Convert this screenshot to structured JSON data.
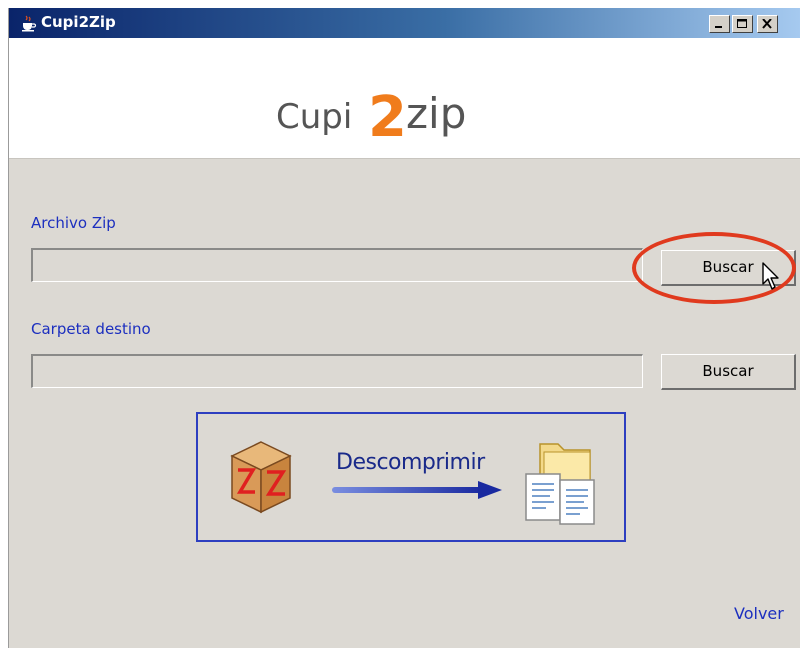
{
  "window": {
    "title": "Cupi2Zip",
    "title_icon": "java-cup-icon",
    "controls": [
      "minimize-icon",
      "maximize-icon",
      "close-icon"
    ]
  },
  "banner": {
    "logo_part1": "Cupi",
    "logo_part2": "2",
    "logo_part3": "zip"
  },
  "form": {
    "zip_label": "Archivo Zip",
    "zip_value": "",
    "zip_button": "Buscar",
    "dest_label": "Carpeta destino",
    "dest_value": "",
    "dest_button": "Buscar"
  },
  "action": {
    "label": "Descomprimir",
    "left_icon": "zip-box-icon",
    "right_icon": "extracted-files-icon"
  },
  "footer": {
    "back_link": "Volver"
  },
  "colors": {
    "label_blue": "#1c2fbf",
    "highlight_red": "#e03a1e",
    "logo_orange": "#f07c1c",
    "logo_gray": "#555555",
    "window_bg": "#dcd9d3"
  }
}
